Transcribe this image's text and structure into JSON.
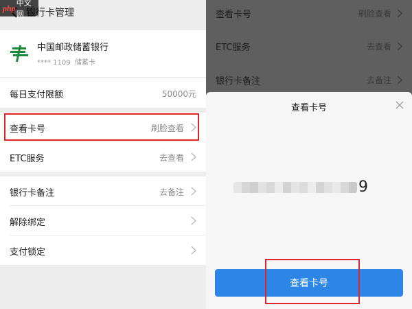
{
  "watermark": {
    "brand": "php",
    "suffix": "中文网"
  },
  "left": {
    "header": {
      "title": "银行卡管理",
      "back_icon": "chevron-left-icon"
    },
    "bank": {
      "name": "中国邮政储蓄银行",
      "masked_number": "**** 1109",
      "card_type": "储蓄卡",
      "logo_icon": "postal-savings-logo",
      "logo_color": "#1a8a3a"
    },
    "rows": [
      {
        "label": "每日支付限额",
        "value": "50000元"
      },
      {
        "label": "查看卡号",
        "value": "刷脸查看"
      },
      {
        "label": "ETC服务",
        "value": "去查看"
      },
      {
        "label": "银行卡备注",
        "value": "去备注"
      },
      {
        "label": "解除绑定",
        "value": ""
      },
      {
        "label": "支付锁定",
        "value": ""
      }
    ]
  },
  "right": {
    "background_rows": [
      {
        "label": "查看卡号",
        "value": "刷脸查看"
      },
      {
        "label": "ETC服务",
        "value": "去查看"
      },
      {
        "label": "银行卡备注",
        "value": "去备注"
      }
    ],
    "sheet": {
      "title": "查看卡号",
      "card_last_digit": "9",
      "button_label": "查看卡号",
      "button_color": "#2d86e6"
    }
  },
  "colors": {
    "highlight": "#e0242f",
    "overlay": "#5f5f5f"
  }
}
